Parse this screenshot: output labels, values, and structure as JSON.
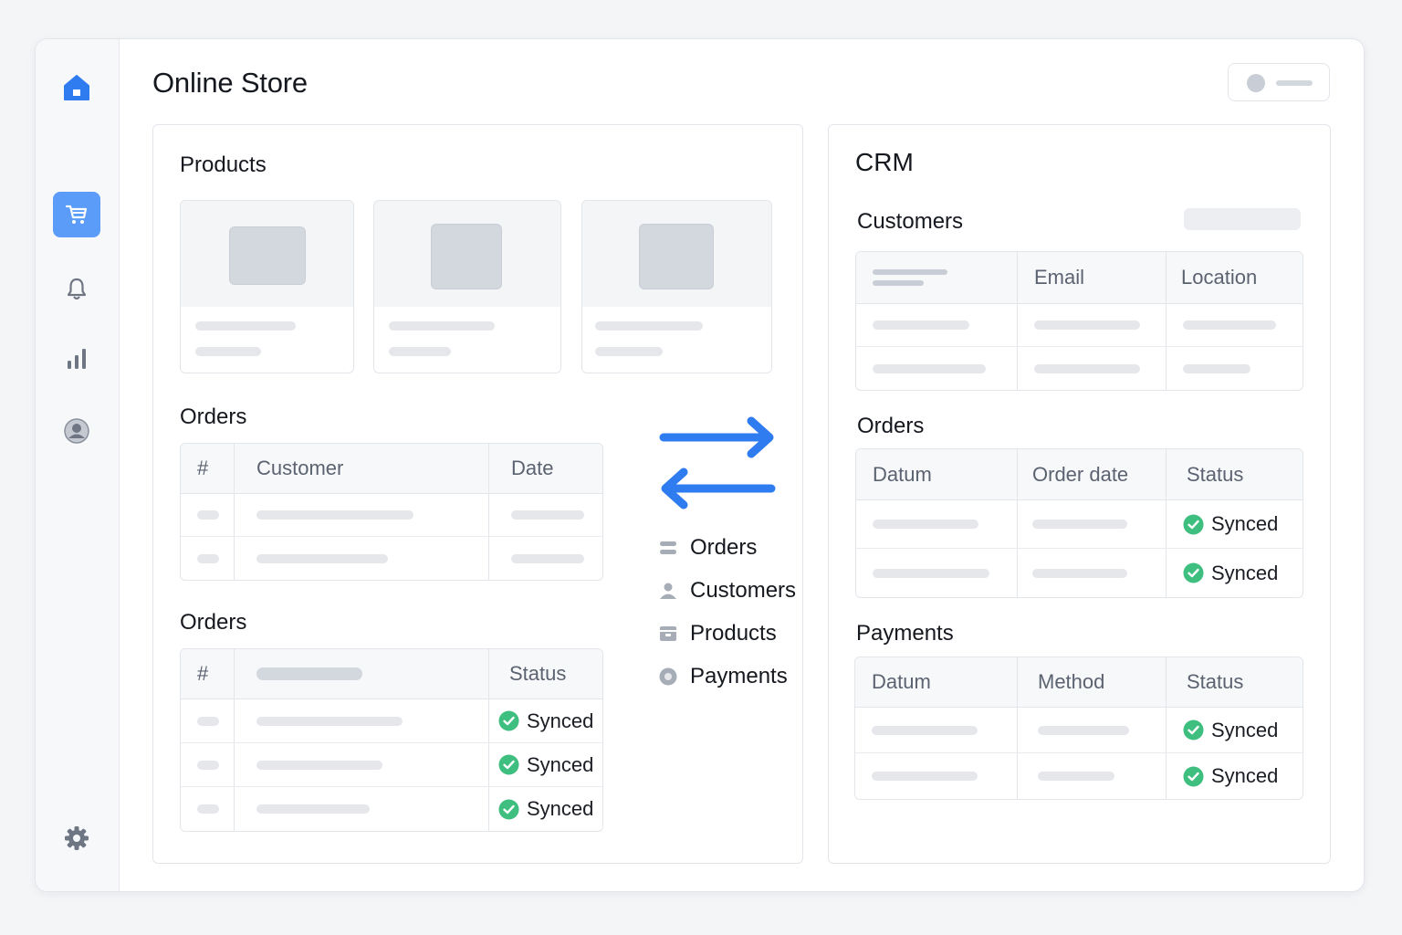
{
  "app": {
    "title": "Online Store"
  },
  "sidebar": {
    "items": [
      {
        "icon": "home-icon",
        "active": false
      },
      {
        "icon": "cart-icon",
        "active": true
      },
      {
        "icon": "bell-icon",
        "active": false
      },
      {
        "icon": "bar-chart-icon",
        "active": false
      },
      {
        "icon": "user-circle-icon",
        "active": false
      },
      {
        "icon": "gear-icon",
        "active": false
      }
    ]
  },
  "store": {
    "products_title": "Products",
    "orders_title": "Orders",
    "orders_headers": [
      "#",
      "Customer",
      "Date"
    ],
    "orders_status_title": "Orders",
    "orders_status_headers": [
      "#",
      "",
      "Status"
    ],
    "orders_status_rows": [
      {
        "status": "Synced"
      },
      {
        "status": "Synced"
      },
      {
        "status": "Synced"
      }
    ]
  },
  "sync": {
    "items": [
      {
        "label": "Orders",
        "icon": "list-icon"
      },
      {
        "label": "Customers",
        "icon": "person-icon"
      },
      {
        "label": "Products",
        "icon": "box-icon"
      },
      {
        "label": "Payments",
        "icon": "coin-icon"
      }
    ]
  },
  "crm": {
    "title": "CRM",
    "customers_title": "Customers",
    "customers_headers": [
      "",
      "Email",
      "Location"
    ],
    "orders_title": "Orders",
    "orders_headers": [
      "Datum",
      "Order date",
      "Status"
    ],
    "orders_rows": [
      {
        "status": "Synced"
      },
      {
        "status": "Synced"
      }
    ],
    "payments_title": "Payments",
    "payments_headers": [
      "Datum",
      "Method",
      "Status"
    ],
    "payments_rows": [
      {
        "status": "Synced"
      },
      {
        "status": "Synced"
      }
    ]
  },
  "colors": {
    "accent": "#2f7bf0",
    "success": "#3fbf7f",
    "skeleton": "#e5e7eb"
  }
}
